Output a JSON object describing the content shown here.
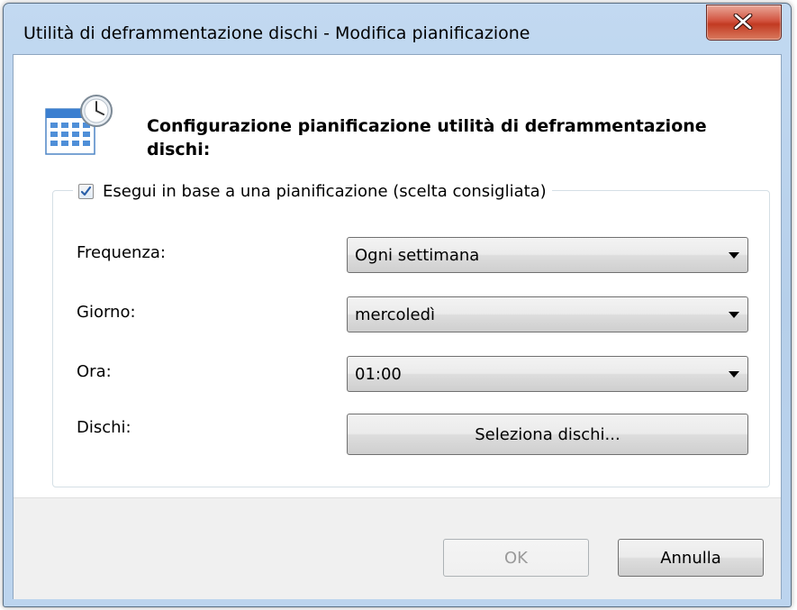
{
  "window": {
    "title": "Utilità di deframmentazione dischi - Modifica pianificazione",
    "close_icon": "close-icon"
  },
  "header": {
    "icon": "calendar-clock-icon",
    "text": "Configurazione pianificazione utilità di deframmentazione dischi:"
  },
  "schedule": {
    "checkbox_label": "Esegui in base a una pianificazione (scelta consigliata)",
    "checked": true,
    "frequency_label": "Frequenza:",
    "frequency_value": "Ogni settimana",
    "day_label": "Giorno:",
    "day_value": "mercoledì",
    "time_label": "Ora:",
    "time_value": "01:00",
    "disks_label": "Dischi:",
    "select_disks_label": "Seleziona dischi..."
  },
  "footer": {
    "ok_label": "OK",
    "ok_enabled": false,
    "cancel_label": "Annulla"
  }
}
